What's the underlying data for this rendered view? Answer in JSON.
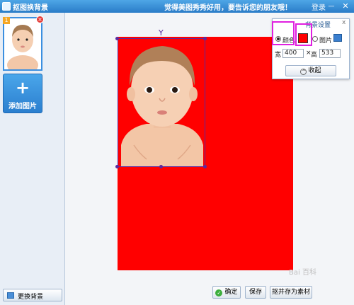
{
  "titlebar": {
    "app_title": "抠图换背景",
    "tagline": "觉得美图秀秀好用，要告诉您的朋友哦！",
    "login_label": "登录",
    "minimize_glyph": "—",
    "close_glyph": "✕"
  },
  "left_panel": {
    "thumbnail_index": "1",
    "add_image_plus": "+",
    "add_image_label": "添加图片",
    "change_bg_label": "更换背景"
  },
  "settings": {
    "title": "背景设置",
    "close_glyph": "x",
    "color_option_label": "颜色",
    "color_selected": true,
    "color_value": "#ff0000",
    "picture_option_label": "图片",
    "width_label": "宽",
    "width_value": "400",
    "times_label": "×",
    "height_label": "高",
    "height_value": "533",
    "collapse_label": "收起",
    "collapse_glyph": "^"
  },
  "bottom_bar": {
    "ok_label": "确定",
    "save_label": "保存",
    "save_as_material_label": "抠并存为素材"
  },
  "canvas": {
    "background_color": "#ff0000",
    "rotate_glyph": "Y"
  },
  "watermark": "Bai 百科"
}
